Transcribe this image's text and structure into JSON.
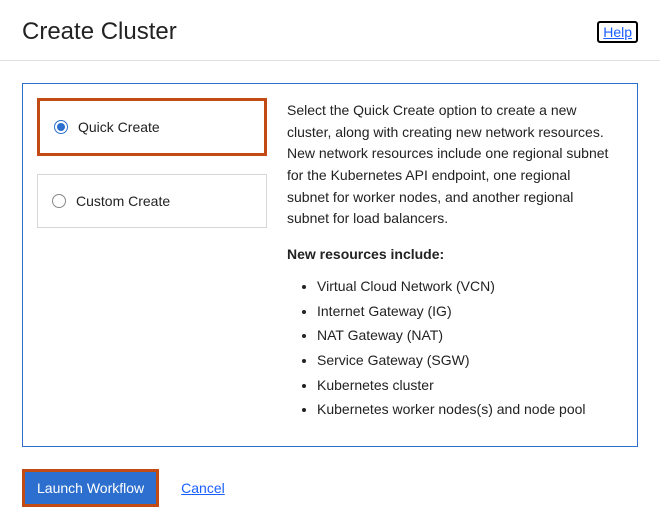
{
  "header": {
    "title": "Create Cluster",
    "help_label": "Help"
  },
  "options": {
    "quick_create": {
      "label": "Quick Create",
      "selected": true
    },
    "custom_create": {
      "label": "Custom Create",
      "selected": false
    }
  },
  "description": {
    "intro": "Select the Quick Create option to create a new cluster, along with creating new network resources. New network resources include one regional subnet for the Kubernetes API endpoint, one regional subnet for worker nodes, and another regional subnet for load balancers.",
    "resources_heading": "New resources include:",
    "resources": [
      "Virtual Cloud Network (VCN)",
      "Internet Gateway (IG)",
      "NAT Gateway (NAT)",
      "Service Gateway (SGW)",
      "Kubernetes cluster",
      "Kubernetes worker nodes(s) and node pool"
    ]
  },
  "actions": {
    "launch_label": "Launch Workflow",
    "cancel_label": "Cancel"
  }
}
